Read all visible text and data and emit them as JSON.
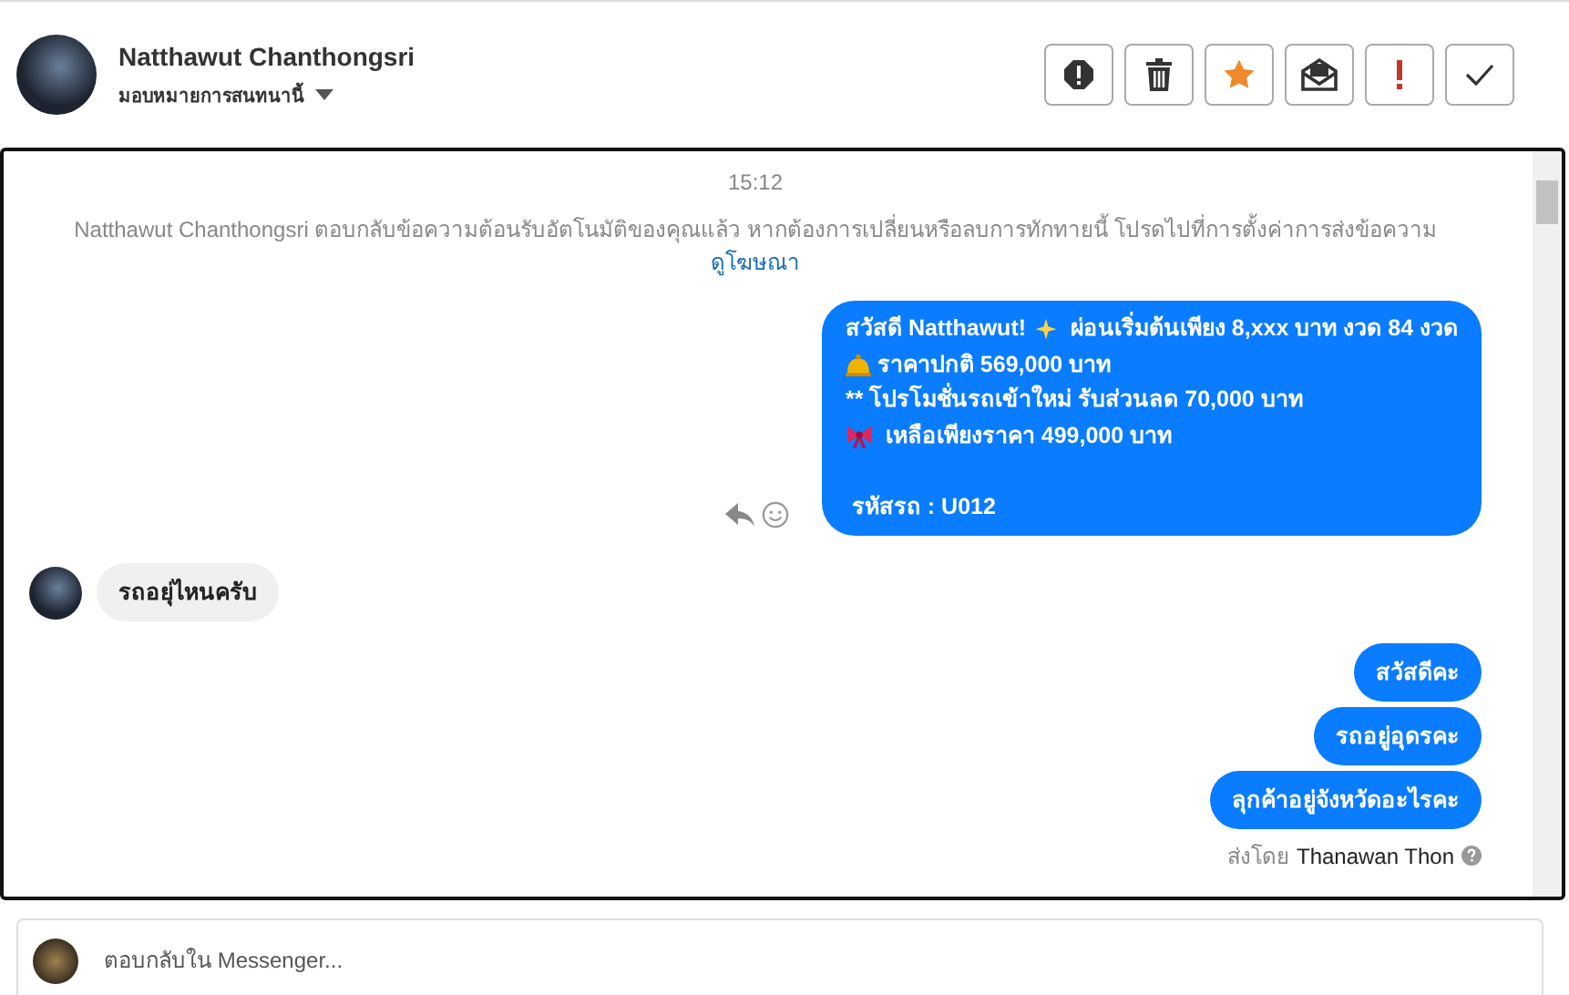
{
  "header": {
    "name": "Natthawut Chanthongsri",
    "assign": "มอบหมายการสนทนานี้",
    "actions": [
      {
        "kind": "alert"
      },
      {
        "kind": "trash"
      },
      {
        "kind": "star"
      },
      {
        "kind": "mail"
      },
      {
        "kind": "important"
      },
      {
        "kind": "check"
      }
    ]
  },
  "chat": {
    "time": "15:12",
    "notice": "Natthawut Chanthongsri ตอบกลับข้อความต้อนรับอัตโนมัติของคุณแล้ว หากต้องการเปลี่ยนหรือลบการทักทายนี้ โปรดไปที่การตั้งค่าการส่งข้อความ",
    "notice_link": "ดูโฆษณา",
    "messages": [
      {
        "kind": "sent",
        "lines": [
          {
            "spaced": false,
            "parts": [
              {
                "kind": "text",
                "text": "สวัสดี Natthawut! "
              },
              {
                "kind": "sparkle"
              },
              {
                "kind": "text",
                "text": "  ผ่อนเริ่มต้นเพียง 8,xxx บาท งวด 84 งวด"
              }
            ]
          },
          {
            "spaced": false,
            "parts": [
              {
                "kind": "bell"
              },
              {
                "kind": "text",
                "text": " ราคาปกติ 569,000 บาท"
              }
            ]
          },
          {
            "spaced": false,
            "parts": [
              {
                "kind": "text",
                "text": "** โปรโมชั่นรถเข้าใหม่ รับส่วนลด 70,000 บาท"
              }
            ]
          },
          {
            "spaced": false,
            "parts": [
              {
                "kind": "bow"
              },
              {
                "kind": "text",
                "text": "  เหลือเพียงราคา 499,000 บาท"
              }
            ]
          },
          {
            "spaced": true,
            "parts": [
              {
                "kind": "text",
                "text": " รหัสรถ : U012"
              }
            ]
          }
        ],
        "tools": true
      },
      {
        "kind": "received",
        "text": "รถอยุ่ไหนครับ"
      },
      {
        "kind": "sent",
        "text": "สวัสดีคะ"
      },
      {
        "kind": "sent",
        "text": "รถอยู่อุดรคะ"
      },
      {
        "kind": "sent",
        "text": "ลุกค้าอยู่จังหวัดอะไรคะ"
      }
    ],
    "sent_by_label": "ส่งโดย",
    "sent_by": "Thanawan Thon"
  },
  "composer": {
    "placeholder": "ตอบกลับใน Messenger..."
  }
}
